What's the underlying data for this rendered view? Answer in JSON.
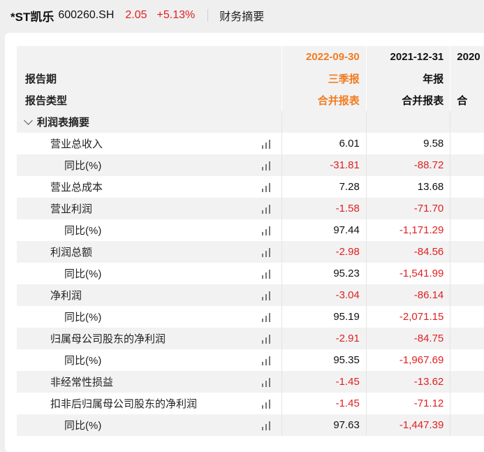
{
  "header": {
    "stock_name": "*ST凯乐",
    "stock_code": "600260.SH",
    "price": "2.05",
    "change": "+5.13%",
    "section": "财务摘要"
  },
  "columns": [
    {
      "date": "2022-09-30",
      "period": "三季报",
      "type": "合并报表"
    },
    {
      "date": "2021-12-31",
      "period": "年报",
      "type": "合并报表"
    },
    {
      "date": "2020",
      "period": "",
      "type": "合"
    }
  ],
  "labels": {
    "report_period": "报告期",
    "report_type": "报告类型",
    "group": "利润表摘要"
  },
  "rows": [
    {
      "label": "营业总收入",
      "v1": "6.01",
      "v2": "9.58"
    },
    {
      "label": "同比(%)",
      "v1": "-31.81",
      "v2": "-88.72"
    },
    {
      "label": "营业总成本",
      "v1": "7.28",
      "v2": "13.68"
    },
    {
      "label": "营业利润",
      "v1": "-1.58",
      "v2": "-71.70"
    },
    {
      "label": "同比(%)",
      "v1": "97.44",
      "v2": "-1,171.29"
    },
    {
      "label": "利润总额",
      "v1": "-2.98",
      "v2": "-84.56"
    },
    {
      "label": "同比(%)",
      "v1": "95.23",
      "v2": "-1,541.99"
    },
    {
      "label": "净利润",
      "v1": "-3.04",
      "v2": "-86.14"
    },
    {
      "label": "同比(%)",
      "v1": "95.19",
      "v2": "-2,071.15"
    },
    {
      "label": "归属母公司股东的净利润",
      "v1": "-2.91",
      "v2": "-84.75"
    },
    {
      "label": "同比(%)",
      "v1": "95.35",
      "v2": "-1,967.69"
    },
    {
      "label": "非经常性损益",
      "v1": "-1.45",
      "v2": "-13.62"
    },
    {
      "label": "扣非后归属母公司股东的净利润",
      "v1": "-1.45",
      "v2": "-71.12"
    },
    {
      "label": "同比(%)",
      "v1": "97.63",
      "v2": "-1,447.39"
    }
  ],
  "colors": {
    "positive": "#e02020",
    "accent": "#f07c20",
    "text": "#111111"
  },
  "icons": {
    "chart": "bar-chart-icon",
    "expand": "chevron-down-icon"
  }
}
